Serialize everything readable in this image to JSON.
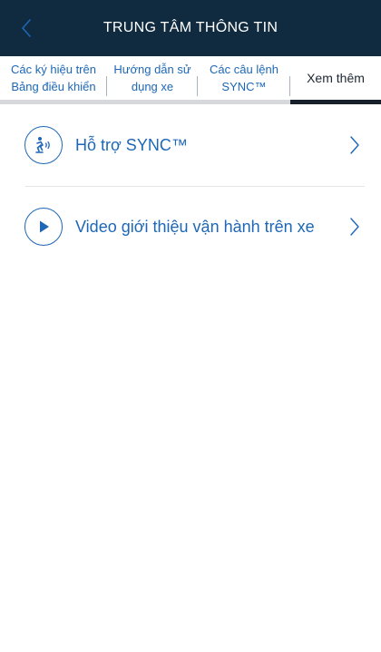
{
  "header": {
    "title": "TRUNG TÂM THÔNG TIN",
    "back_icon": "chevron-left-icon"
  },
  "tabs": [
    {
      "label": "Các ký hiệu trên\nBảng điều khiển",
      "active": false
    },
    {
      "label": "Hướng dẫn sử\ndụng xe",
      "active": false
    },
    {
      "label": "Các câu lệnh\nSYNC™",
      "active": false
    },
    {
      "label": "Xem thêm",
      "active": true
    }
  ],
  "list": {
    "items": [
      {
        "label": "Hỗ trợ SYNC™",
        "icon": "voice-assist-icon"
      },
      {
        "label": "Video giới thiệu vận hành trên xe",
        "icon": "play-icon"
      }
    ]
  },
  "colors": {
    "header_bg": "#102b3f",
    "accent": "#1d67b6",
    "active_tab_bar": "#17202a",
    "tab_track": "#d6d8db"
  }
}
